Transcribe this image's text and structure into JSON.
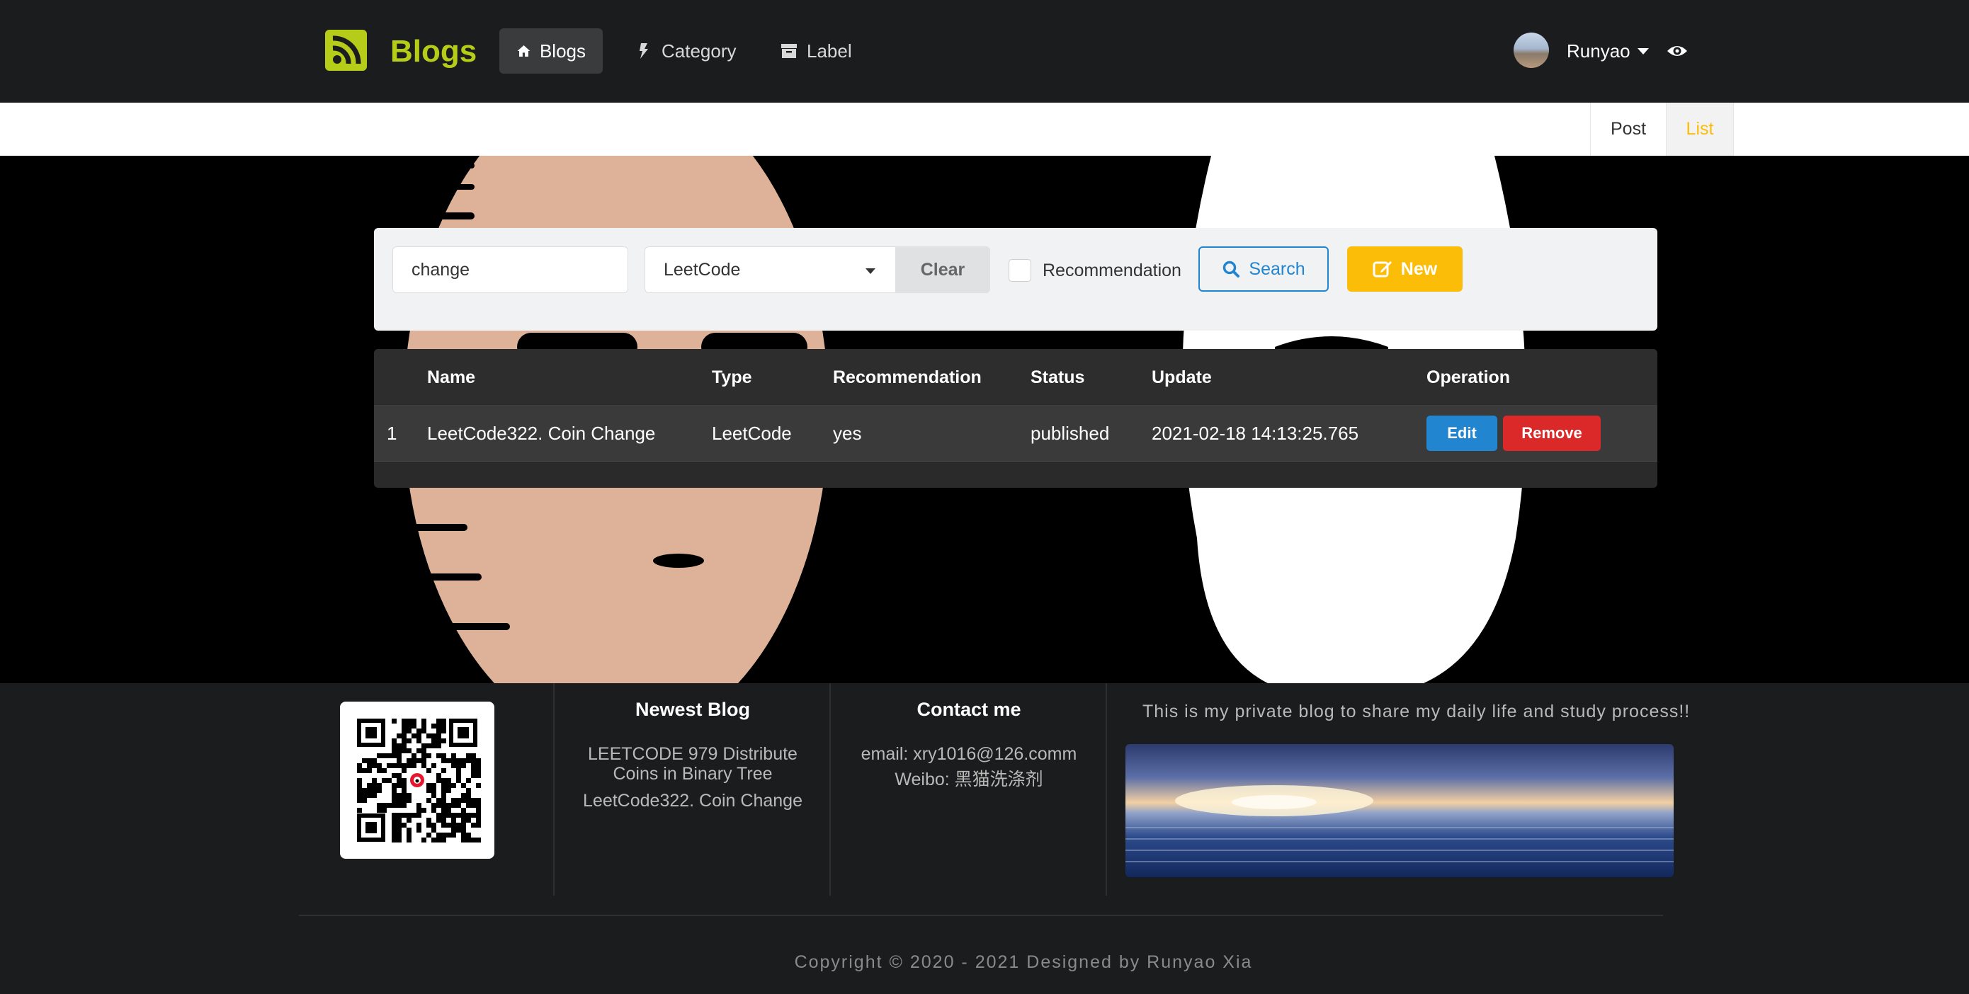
{
  "nav": {
    "brand": "Blogs",
    "items": [
      {
        "label": "Blogs",
        "icon": "home-icon",
        "active": true
      },
      {
        "label": "Category",
        "icon": "bolt-icon",
        "active": false
      },
      {
        "label": "Label",
        "icon": "archive-icon",
        "active": false
      }
    ],
    "user_name": "Runyao"
  },
  "submenu": {
    "post_label": "Post",
    "list_label": "List"
  },
  "search": {
    "title_value": "change",
    "type_value": "LeetCode",
    "clear_label": "Clear",
    "recommend_label": "Recommendation",
    "search_label": "Search",
    "new_label": "New"
  },
  "table": {
    "headers": [
      "",
      "Name",
      "Type",
      "Recommendation",
      "Status",
      "Update",
      "Operation"
    ],
    "rows": [
      {
        "index": "1",
        "name": "LeetCode322. Coin Change",
        "type": "LeetCode",
        "recommendation": "yes",
        "status": "published",
        "update": "2021-02-18 14:13:25.765",
        "edit_label": "Edit",
        "remove_label": "Remove"
      }
    ]
  },
  "footer": {
    "newest_title": "Newest Blog",
    "newest_items": [
      "LEETCODE 979 Distribute",
      "Coins in Binary Tree",
      "LeetCode322. Coin Change"
    ],
    "contact_title": "Contact me",
    "email": "email: xry1016@126.comm",
    "weibo": "Weibo: 黑猫洗涤剂",
    "tagline": "This is my private blog to share my daily life and study process!!",
    "copyright": "Copyright © 2020 - 2021 Designed by Runyao Xia"
  },
  "colors": {
    "accent_olive": "#b5cc18",
    "accent_yellow": "#fbbd08",
    "primary_blue": "#2185d0",
    "danger_red": "#db2828",
    "nav_bg": "#1b1c1d"
  }
}
